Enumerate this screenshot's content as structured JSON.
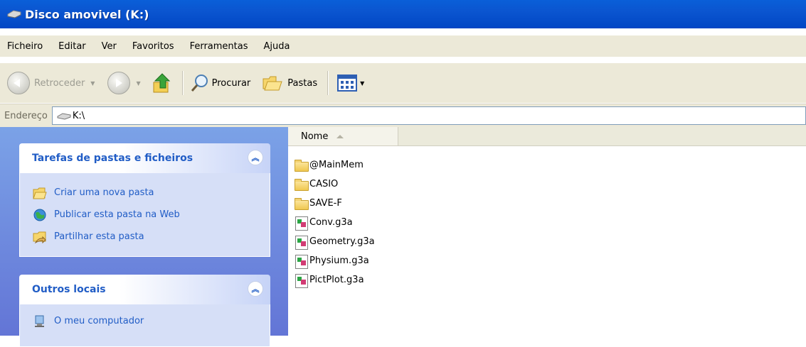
{
  "window": {
    "title": "Disco amovivel (K:)",
    "icon": "removable-drive-icon"
  },
  "menu": [
    "Ficheiro",
    "Editar",
    "Ver",
    "Favoritos",
    "Ferramentas",
    "Ajuda"
  ],
  "toolbar": {
    "back_label": "Retroceder",
    "search_label": "Procurar",
    "folders_label": "Pastas"
  },
  "address": {
    "label": "Endereço",
    "value": "K:\\"
  },
  "panels": [
    {
      "title": "Tarefas de pastas e ficheiros",
      "tasks": [
        {
          "label": "Criar uma nova pasta",
          "icon": "new-folder-icon"
        },
        {
          "label": "Publicar esta pasta na Web",
          "icon": "publish-web-icon"
        },
        {
          "label": "Partilhar esta pasta",
          "icon": "share-folder-icon"
        }
      ]
    },
    {
      "title": "Outros locais",
      "tasks": [
        {
          "label": "O meu computador",
          "icon": "my-computer-icon"
        }
      ]
    }
  ],
  "file_list": {
    "column_name": "Nome",
    "items": [
      {
        "name": "@MainMem",
        "type": "folder"
      },
      {
        "name": "CASIO",
        "type": "folder"
      },
      {
        "name": "SAVE-F",
        "type": "folder"
      },
      {
        "name": "Conv.g3a",
        "type": "g3a"
      },
      {
        "name": "Geometry.g3a",
        "type": "g3a"
      },
      {
        "name": "Physium.g3a",
        "type": "g3a"
      },
      {
        "name": "PictPlot.g3a",
        "type": "g3a"
      }
    ]
  },
  "colors": {
    "title_bar": "#0055e5",
    "task_pane_link": "#215dc6",
    "task_pane_bg": "#6d8fe0"
  }
}
